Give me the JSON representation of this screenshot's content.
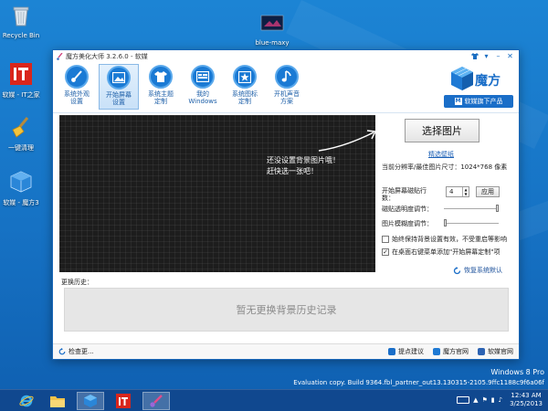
{
  "desktop": {
    "icons": [
      {
        "label": "Recycle Bin"
      },
      {
        "label": "软媒 - IT之家"
      },
      {
        "label": "一键清理"
      },
      {
        "label": "软媒 - 魔方3"
      },
      {
        "label": "blue-maxy"
      }
    ],
    "watermark": {
      "line1": "Windows 8 Pro",
      "line2": "Evaluation copy. Build 9364.fbl_partner_out13.130315-2105.9ffc1188c9f6a06f"
    }
  },
  "window": {
    "title": "魔方美化大师 3.2.6.0 - 软媒",
    "toolbar": [
      {
        "label": "系统外观设置",
        "line1": "系统外观",
        "line2": "设置",
        "icon": "brush-icon"
      },
      {
        "label": "开始屏幕设置",
        "line1": "开始屏幕",
        "line2": "设置",
        "icon": "picture-icon"
      },
      {
        "label": "系统主题定制",
        "line1": "系统主题",
        "line2": "定制",
        "icon": "shirt-icon"
      },
      {
        "label": "我的Windows",
        "line1": "我的",
        "line2": "Windows",
        "icon": "window-icon"
      },
      {
        "label": "系统图标定制",
        "line1": "系统图标",
        "line2": "定制",
        "icon": "star-icon"
      },
      {
        "label": "开机声音方案",
        "line1": "开机声音",
        "line2": "方案",
        "icon": "music-note-icon"
      }
    ],
    "logo": {
      "name": "魔方",
      "button": "软媒旗下产品"
    },
    "preview": {
      "message_line1": "还没设置背景图片哦！",
      "message_line2": "赶快选一张吧！"
    },
    "panel": {
      "select_button": "选择图片",
      "wallpaper_link": "精选壁纸",
      "resolution_text": "当前分辨率/最佳图片尺寸：1024*768 像素",
      "tile_rows_label_1": "开始屏幕磁贴行",
      "tile_rows_label_2": "数：",
      "tile_rows_value": "4",
      "apply_button": "应用",
      "opacity_label": "磁贴透明度调节：",
      "opacity_value": 1.0,
      "blur_label": "图片模糊度调节：",
      "blur_value": 0.0,
      "option_keep": {
        "label": "始终保持背景设置有效，不受重启等影响",
        "checked": false
      },
      "option_menu": {
        "label": "在桌面右键菜单添加\"开始屏幕定制\"项",
        "checked": true
      },
      "restore_default": "恢复系统默认"
    },
    "history": {
      "title": "更换历史：",
      "empty_text": "暂无更换背景历史记录"
    },
    "statusbar": {
      "check_update": "检查更...",
      "feedback": "提点建议",
      "website_mofang": "魔方官网",
      "website_ruanmei": "软媒官网"
    }
  },
  "taskbar": {
    "clock_time": "12:43 AM",
    "clock_date": "3/25/2013"
  }
}
